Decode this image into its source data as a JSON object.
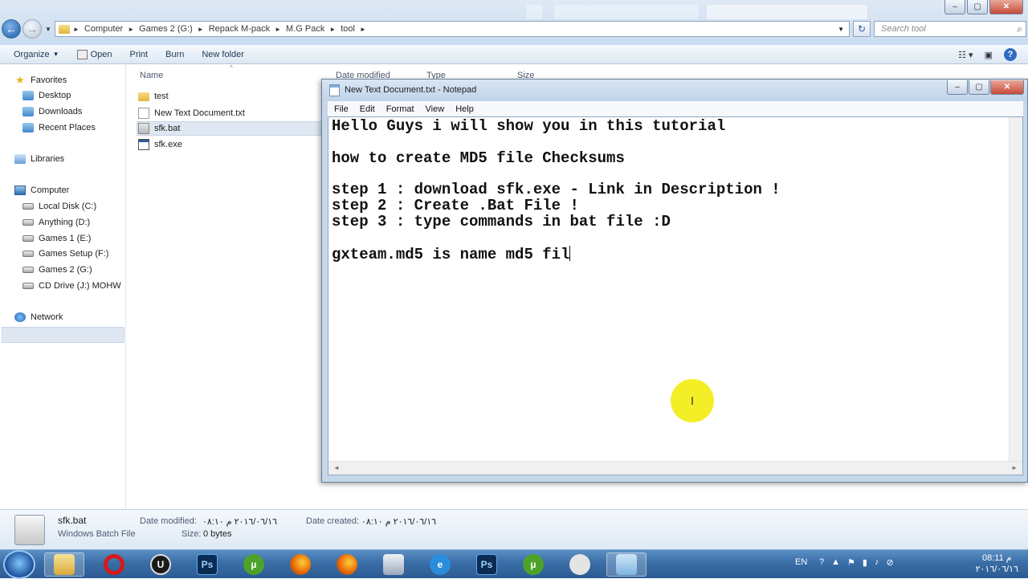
{
  "window": {
    "address": [
      "Computer",
      "Games 2 (G:)",
      "Repack M-pack",
      "M.G Pack",
      "tool"
    ],
    "search_placeholder": "Search tool"
  },
  "toolbar": {
    "organize": "Organize",
    "open": "Open",
    "print": "Print",
    "burn": "Burn",
    "new_folder": "New folder"
  },
  "nav": {
    "favorites": "Favorites",
    "desktop": "Desktop",
    "downloads": "Downloads",
    "recent": "Recent Places",
    "libraries": "Libraries",
    "computer": "Computer",
    "local_c": "Local Disk (C:)",
    "anything_d": "Anything (D:)",
    "games1_e": "Games 1 (E:)",
    "games_setup_f": "Games Setup (F:)",
    "games2_g": "Games 2 (G:)",
    "cd_j": "CD Drive (J:) MOHW",
    "network": "Network"
  },
  "columns": {
    "name": "Name",
    "date_modified": "Date modified",
    "type": "Type",
    "size": "Size"
  },
  "files": [
    "test",
    "New Text Document.txt",
    "sfk.bat",
    "sfk.exe"
  ],
  "notepad": {
    "title": "New Text Document.txt - Notepad",
    "menu": [
      "File",
      "Edit",
      "Format",
      "View",
      "Help"
    ],
    "lines": [
      "Hello Guys i will show you in this tutorial",
      "",
      "how to create MD5 file Checksums",
      "",
      "step 1 : download sfk.exe - Link in Description !",
      "step 2 : Create .Bat File !",
      "step 3 : type commands in bat file :D",
      "",
      "gxteam.md5 is name md5 fil"
    ]
  },
  "details": {
    "name": "sfk.bat",
    "type": "Windows Batch File",
    "date_modified_label": "Date modified:",
    "date_modified": "٢٠١٦/٠٦/١٦ م ٠٨:١٠",
    "date_created_label": "Date created:",
    "date_created": "٢٠١٦/٠٦/١٦ م ٠٨:١٠",
    "size_label": "Size:",
    "size": "0 bytes"
  },
  "taskbar": {
    "lang": "EN",
    "time": "08:11 م",
    "date": "٢٠١٦/٠٦/١٦"
  },
  "colors": {
    "accent": "#3a6da6",
    "cursor_highlight": "#f4ee1c"
  }
}
